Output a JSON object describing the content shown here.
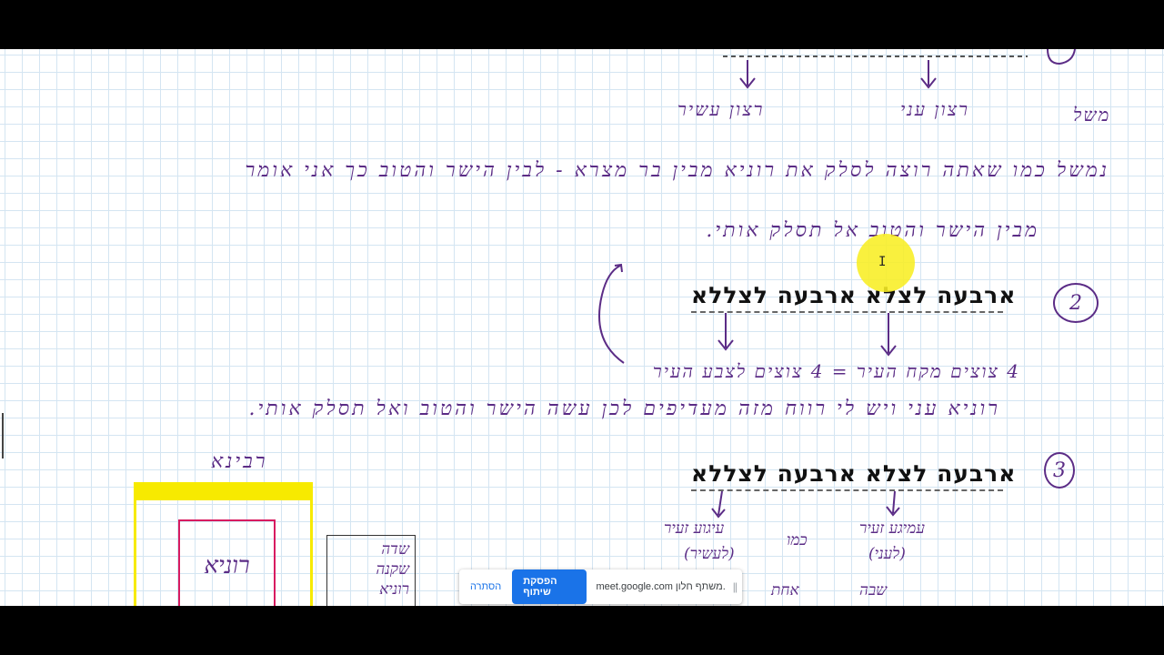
{
  "meeting_share_bar": {
    "hide_label": "הסתרה",
    "stop_sharing_label": "הפסקת שיתוף",
    "sharing_text": "meet.google.com משתף חלון.",
    "grip_glyph": "||"
  },
  "notes": {
    "step_numbers": [
      "2",
      "3"
    ],
    "printed_phrase_2": "ארבעה לצלא ארבעה לצללא",
    "printed_phrase_3": "ארבעה לצלא ארבעה לצללא",
    "line1_left": "משל",
    "line1_word_a": "רצון עני",
    "line1_word_b": "רצון עשיר",
    "line2": "נמשל כמו שאתה רוצה לסלק את רוניא מבין בר מצרא - לבין הישר והטוב כך אני אומר",
    "line3": "מבין הישר והטוב אל תסלק אותי.",
    "line4": "4 צוצים מקח העיר = 4 צוצים לצבע העיר",
    "line5": "רוניא עני ויש לי רווח מזה מעדיפים לכן עשה הישר והטוב ואל תסלק אותי.",
    "label_ravina": "רבינא",
    "box_pink_label": "רוניא",
    "box_gray_lines": [
      "שדה",
      "שקנה",
      "רוניא"
    ],
    "step3_left_note_1": "עיגוע זעיר",
    "step3_left_note_2": "(לעשיר)",
    "step3_middle_note": "כמו",
    "step3_right_note_1": "עמיגע זעיר",
    "step3_right_note_2": "(לעני)",
    "bottom_left": "אחת",
    "bottom_right": "שבה"
  },
  "colors": {
    "ink_purple": "#5b2c86",
    "ink_pink": "#c2185b",
    "highlight_yellow": "#f8ee23",
    "google_blue": "#1a73e8"
  }
}
